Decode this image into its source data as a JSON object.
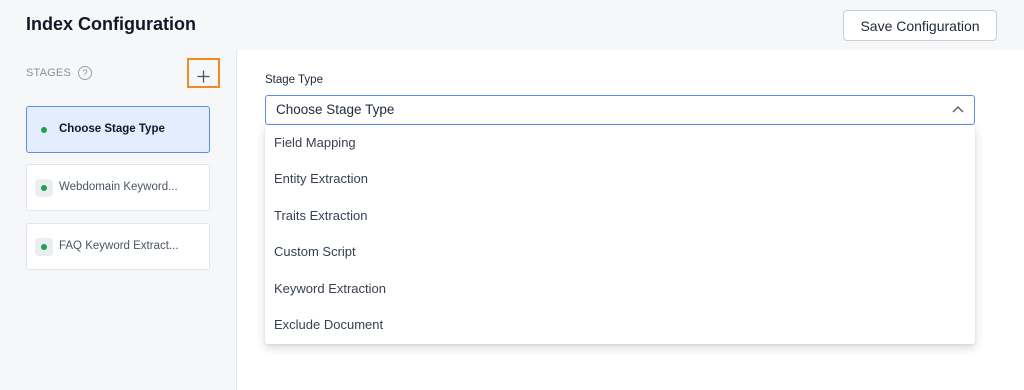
{
  "header": {
    "title": "Index Configuration",
    "save_label": "Save Configuration"
  },
  "sidebar": {
    "stages_label": "STAGES",
    "help_glyph": "?",
    "add_icon": "plus-icon",
    "stages": [
      {
        "name": "Choose Stage Type",
        "status_color": "#22a146",
        "active": true
      },
      {
        "name": "Webdomain Keyword...",
        "status_color": "#22a146",
        "active": false
      },
      {
        "name": "FAQ Keyword Extract...",
        "status_color": "#22a146",
        "active": false
      }
    ]
  },
  "main": {
    "stage_type_label": "Stage Type",
    "select": {
      "value": "Choose Stage Type",
      "icon": "chevron-up-icon",
      "expanded": true
    },
    "options": [
      "Field Mapping",
      "Entity Extraction",
      "Traits Extraction",
      "Custom Script",
      "Keyword Extraction",
      "Exclude Document"
    ]
  },
  "colors": {
    "accent": "#2f6fdf",
    "active_card_bg": "#e3edfd",
    "active_card_border": "#5b8def",
    "add_button_highlight": "#f08a24",
    "status_green": "#22a146"
  }
}
